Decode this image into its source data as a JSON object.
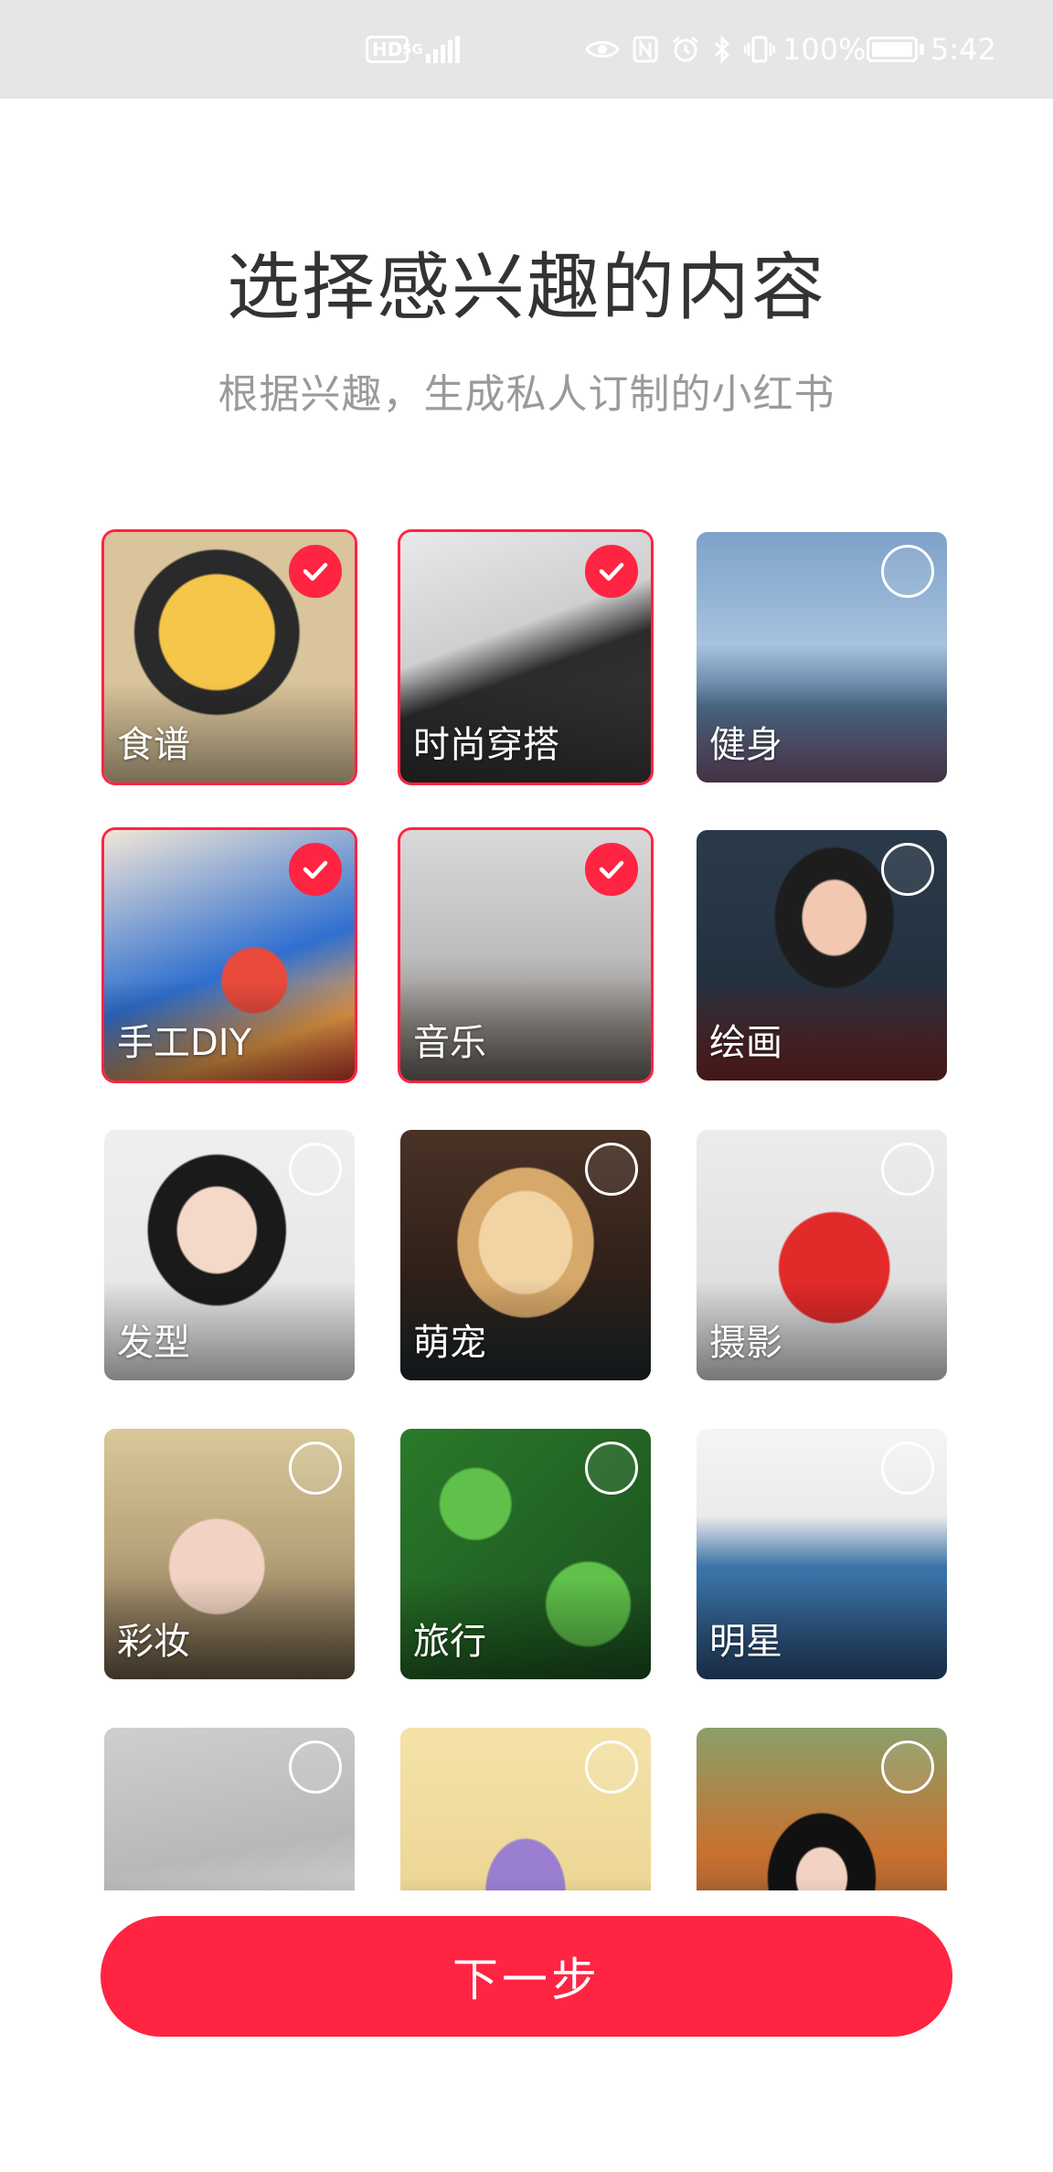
{
  "status_bar": {
    "hd": "HD",
    "network": "5G",
    "icons": [
      "eye-icon",
      "nfc-icon",
      "alarm-icon",
      "bluetooth-icon",
      "vibrate-icon"
    ],
    "battery_percent": "100%",
    "battery_level": 1.0,
    "time": "5:42"
  },
  "header": {
    "title": "选择感兴趣的内容",
    "subtitle": "根据兴趣，生成私人订制的小红书"
  },
  "interests": [
    {
      "label": "食谱",
      "selected": true
    },
    {
      "label": "时尚穿搭",
      "selected": true
    },
    {
      "label": "健身",
      "selected": false
    },
    {
      "label": "手工DIY",
      "selected": true
    },
    {
      "label": "音乐",
      "selected": true
    },
    {
      "label": "绘画",
      "selected": false
    },
    {
      "label": "发型",
      "selected": false
    },
    {
      "label": "萌宠",
      "selected": false
    },
    {
      "label": "摄影",
      "selected": false
    },
    {
      "label": "彩妆",
      "selected": false
    },
    {
      "label": "旅行",
      "selected": false
    },
    {
      "label": "明星",
      "selected": false
    },
    {
      "label": "",
      "selected": false
    },
    {
      "label": "",
      "selected": false
    },
    {
      "label": "",
      "selected": false
    }
  ],
  "next_button": {
    "label": "下一步"
  },
  "colors": {
    "accent": "#ff2442",
    "title": "#333333",
    "subtitle": "#9a9a9a",
    "status_bar_bg": "#e6e6e6"
  }
}
